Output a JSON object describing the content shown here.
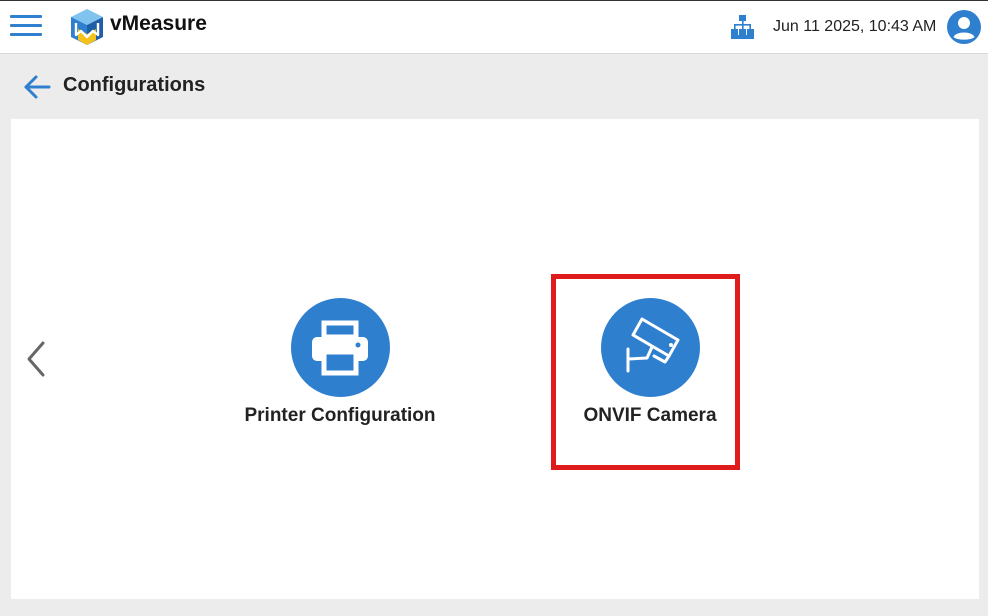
{
  "app": {
    "brand": "vMeasure",
    "datetime": "Jun 11 2025, 10:43 AM"
  },
  "icons": {
    "menu": "hamburger-menu-icon",
    "logo": "vmeasure-cube-logo",
    "network": "network-hierarchy-icon",
    "avatar": "user-avatar-icon",
    "back": "arrow-left-icon",
    "prev": "chevron-left-icon",
    "printer": "printer-icon",
    "camera": "cctv-camera-icon"
  },
  "colors": {
    "accent": "#2f7fcf",
    "highlight": "#e01b1b",
    "background": "#ececec"
  },
  "page": {
    "title": "Configurations"
  },
  "tiles": [
    {
      "label": "Printer Configuration"
    },
    {
      "label": "ONVIF Camera"
    }
  ]
}
